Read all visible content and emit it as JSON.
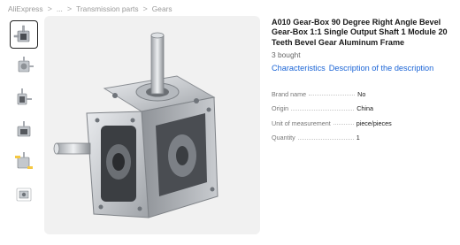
{
  "breadcrumb": {
    "items": [
      "AliExpress",
      "...",
      "Transmission parts",
      "Gears"
    ],
    "separator": ">"
  },
  "gallery": {
    "thumbnail_count": 6,
    "active_index": 0,
    "background": "#f1f1f1",
    "icon": "gearbox-product-image"
  },
  "product": {
    "title": "A010 Gear-Box 90 Degree Right Angle Bevel Gear-Box 1:1 Single Output Shaft 1 Module 20 Teeth Bevel Gear Aluminum Frame",
    "sold": "3 bought",
    "tabs": [
      "Characteristics",
      "Description of the description"
    ]
  },
  "specs": [
    {
      "key": "Brand name",
      "value": "No"
    },
    {
      "key": "Origin",
      "value": "China"
    },
    {
      "key": "Unit of measurement",
      "value": "piece/pieces"
    },
    {
      "key": "Quantity",
      "value": "1"
    }
  ],
  "colors": {
    "link": "#1a64d6",
    "text": "#191919",
    "muted": "#999999"
  }
}
